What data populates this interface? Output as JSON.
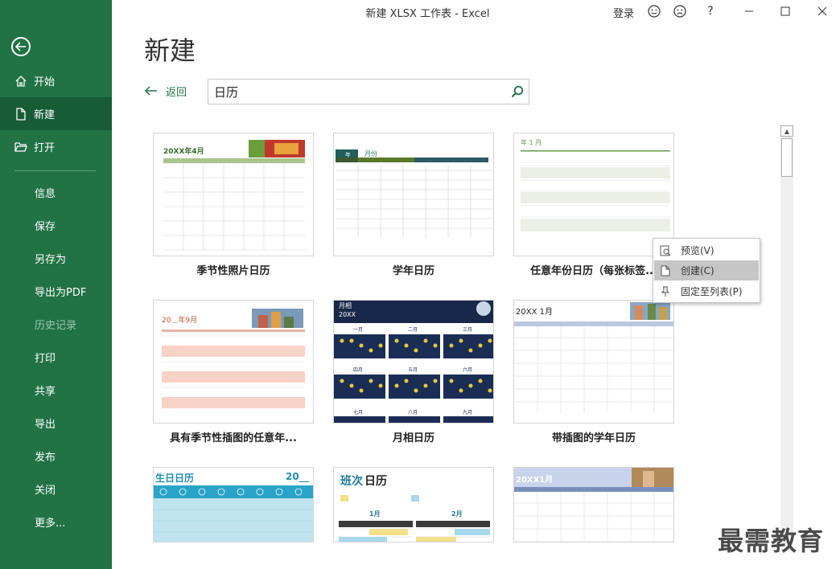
{
  "window": {
    "title": "新建 XLSX 工作表  -  Excel",
    "login": "登录",
    "help": "?"
  },
  "sidebar": {
    "items": [
      {
        "label": "开始"
      },
      {
        "label": "新建"
      },
      {
        "label": "打开"
      },
      {
        "label": "信息"
      },
      {
        "label": "保存"
      },
      {
        "label": "另存为"
      },
      {
        "label": "导出为PDF"
      },
      {
        "label": "历史记录"
      },
      {
        "label": "打印"
      },
      {
        "label": "共享"
      },
      {
        "label": "导出"
      },
      {
        "label": "发布"
      },
      {
        "label": "关闭"
      },
      {
        "label": "更多..."
      }
    ]
  },
  "main": {
    "title": "新建",
    "back_label": "返回",
    "search_value": "日历"
  },
  "templates": [
    {
      "label": "季节性照片日历",
      "thumb_title": "20XX年4月"
    },
    {
      "label": "学年日历",
      "thumb_title": "月份",
      "thumb_tag": "年"
    },
    {
      "label": "任意年份日历（每张标签...",
      "thumb_title": "年 1 月"
    },
    {
      "label": "具有季节性插图的任意年...",
      "thumb_title": "20＿年9月"
    },
    {
      "label": "月相日历",
      "thumb_title": "月相",
      "thumb_sub": "20XX",
      "months": [
        "一月",
        "二月",
        "三月",
        "四月",
        "五月",
        "六月",
        "七月",
        "八月",
        "九月"
      ]
    },
    {
      "label": "带插图的学年日历",
      "thumb_title": "20XX 1月"
    },
    {
      "label": "",
      "thumb_title": "生日日历",
      "thumb_year": "20__"
    },
    {
      "label": "",
      "thumb_title_a": "班次",
      "thumb_title_b": "日历",
      "months": [
        "1月",
        "2月"
      ]
    },
    {
      "label": "",
      "thumb_title": "20XX1月"
    }
  ],
  "context_menu": {
    "items": [
      {
        "label": "预览(V)"
      },
      {
        "label": "创建(C)"
      },
      {
        "label": "固定至列表(P)"
      }
    ]
  },
  "watermark": "最需教育",
  "colors": {
    "sidebar_bg": "#217346",
    "sidebar_active": "#185c37",
    "accent": "#217346"
  }
}
